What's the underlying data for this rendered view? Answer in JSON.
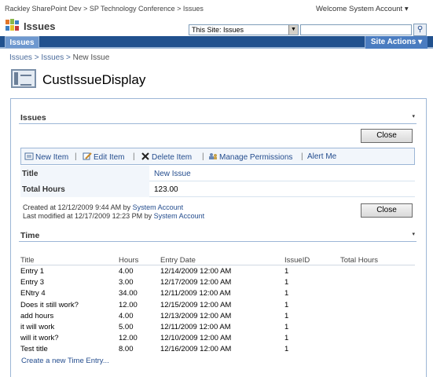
{
  "topbar": {
    "breadcrumb": [
      "Rackley SharePoint Dev",
      "SP Technology Conference",
      "Issues"
    ],
    "sep": ">",
    "welcome": "Welcome System Account ▾"
  },
  "site": {
    "title": "Issues",
    "scope": "This Site: Issues",
    "search_value": ""
  },
  "nav": {
    "tab": "Issues",
    "site_actions": "Site Actions ▾"
  },
  "crumb": {
    "items": [
      "Issues",
      "Issues",
      "New Issue"
    ],
    "sep": ">"
  },
  "page": {
    "title": "CustIssueDisplay"
  },
  "issues_part": {
    "title": "Issues",
    "menu": "▾",
    "close_label": "Close",
    "toolbar": {
      "new_item": "New Item",
      "edit_item": "Edit Item",
      "delete_item": "Delete Item",
      "manage_permissions": "Manage Permissions",
      "alert_me": "Alert Me"
    },
    "fields": [
      {
        "label": "Title",
        "value": "New Issue"
      },
      {
        "label": "Total Hours",
        "value": "123.00"
      }
    ],
    "created": {
      "prefix": "Created at 12/12/2009 9:44 AM  by",
      "user": "System Account"
    },
    "modified": {
      "prefix": "Last modified at 12/17/2009 12:23 PM  by",
      "user": "System Account"
    },
    "close2_label": "Close"
  },
  "time_part": {
    "title": "Time",
    "menu": "▾",
    "columns": [
      "Title",
      "Hours",
      "Entry Date",
      "IssueID",
      "Total Hours"
    ],
    "rows": [
      [
        "Entry 1",
        "4.00",
        "12/14/2009 12:00 AM",
        "1",
        ""
      ],
      [
        "Entry 3",
        "3.00",
        "12/17/2009 12:00 AM",
        "1",
        ""
      ],
      [
        "ENtry 4",
        "34.00",
        "12/11/2009 12:00 AM",
        "1",
        ""
      ],
      [
        "Does it still work?",
        "12.00",
        "12/15/2009 12:00 AM",
        "1",
        ""
      ],
      [
        "add hours",
        "4.00",
        "12/13/2009 12:00 AM",
        "1",
        ""
      ],
      [
        "it will work",
        "5.00",
        "12/11/2009 12:00 AM",
        "1",
        ""
      ],
      [
        "will it work?",
        "12.00",
        "12/10/2009 12:00 AM",
        "1",
        ""
      ],
      [
        "Test title",
        "8.00",
        "12/16/2009 12:00 AM",
        "1",
        ""
      ]
    ],
    "create_link": "Create a new Time Entry..."
  }
}
